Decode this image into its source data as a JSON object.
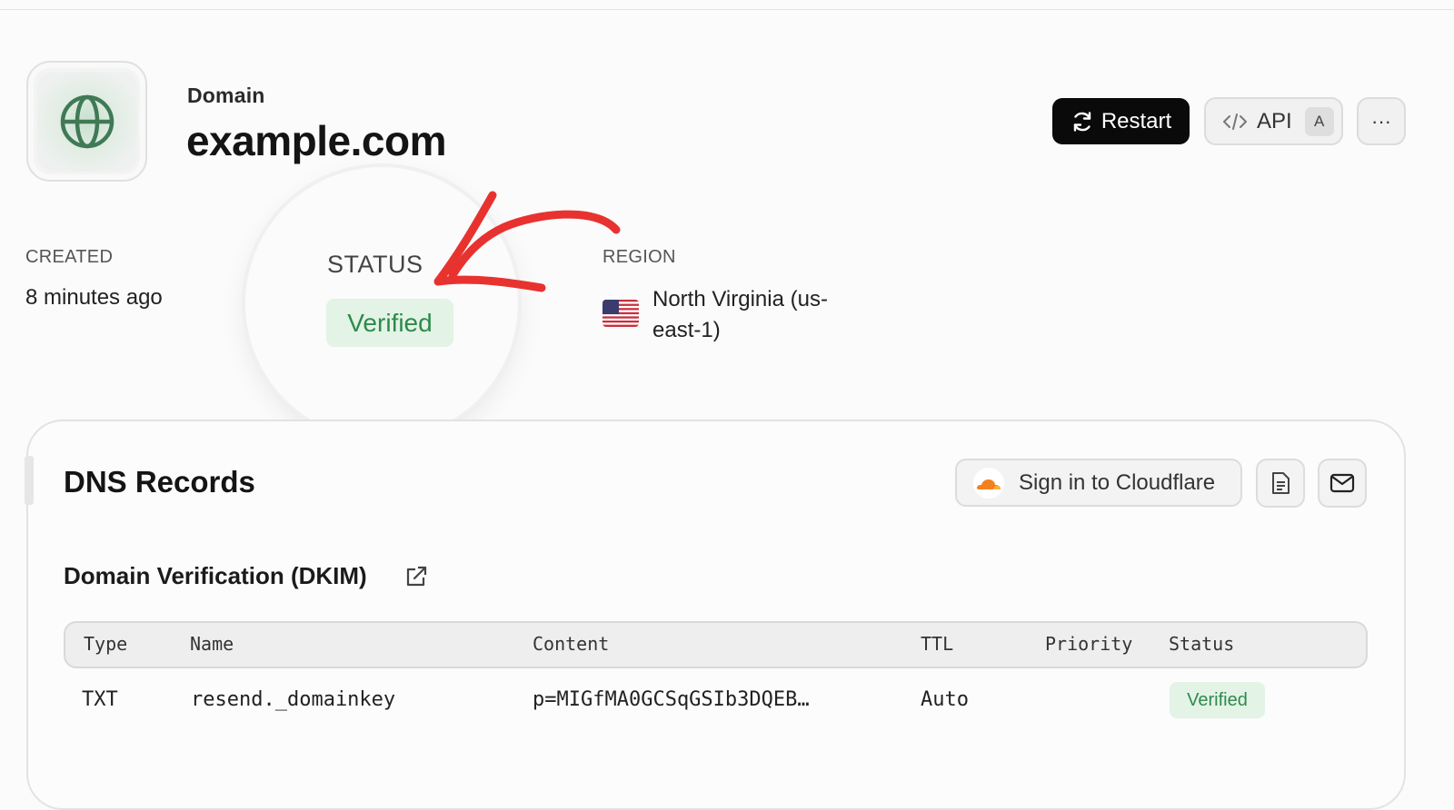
{
  "header": {
    "label": "Domain",
    "domain": "example.com",
    "logo_icon": "globe-icon"
  },
  "actions": {
    "restart_label": "Restart",
    "api_label": "API",
    "api_shortcut": "A",
    "more_label": "···"
  },
  "meta": {
    "created_label": "CREATED",
    "created_value": "8 minutes ago",
    "status_label": "STATUS",
    "status_value": "Verified",
    "region_label": "REGION",
    "region_value": "North Virginia (us-east-1)",
    "region_flag": "us-flag-icon"
  },
  "dns": {
    "title": "DNS Records",
    "cloudflare_label": "Sign in to Cloudflare",
    "section_title": "Domain Verification (DKIM)",
    "columns": [
      "Type",
      "Name",
      "Content",
      "TTL",
      "Priority",
      "Status"
    ],
    "rows": [
      {
        "type": "TXT",
        "name": "resend._domainkey",
        "content": "p=MIGfMA0GCSqGSIb3DQEB…",
        "ttl": "Auto",
        "priority": "",
        "status": "Verified"
      }
    ]
  },
  "colors": {
    "verified_text": "#2d8a4b",
    "verified_bg": "#e3f3e6",
    "annotation_arrow": "#e8322f",
    "cloudflare_orange": "#f38020"
  }
}
